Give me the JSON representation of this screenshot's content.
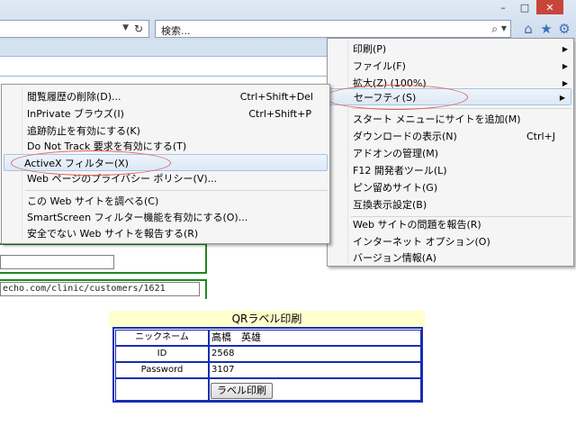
{
  "browser": {
    "search_placeholder": "検索...",
    "window_controls": [
      "–",
      "□",
      "✕"
    ],
    "icons": [
      "home-icon",
      "favorites-star-icon",
      "tools-gear-icon"
    ]
  },
  "page": {
    "url_text": "echo.com/clinic/customers/1621"
  },
  "tools_menu": {
    "items": [
      {
        "label": "印刷(P)",
        "submenu": true
      },
      {
        "label": "ファイル(F)",
        "submenu": true
      },
      {
        "label": "拡大(Z) (100%)",
        "submenu": true
      },
      {
        "label": "セーフティ(S)",
        "submenu": true,
        "highlighted": true
      },
      {
        "label": "スタート メニューにサイトを追加(M)"
      },
      {
        "label": "ダウンロードの表示(N)",
        "shortcut": "Ctrl+J"
      },
      {
        "label": "アドオンの管理(M)"
      },
      {
        "label": "F12 開発者ツール(L)"
      },
      {
        "label": "ピン留めサイト(G)"
      },
      {
        "label": "互換表示設定(B)"
      },
      {
        "label": "Web サイトの問題を報告(R)"
      },
      {
        "label": "インターネット オプション(O)"
      },
      {
        "label": "バージョン情報(A)"
      }
    ]
  },
  "safety_menu": {
    "items": [
      {
        "label": "閲覧履歴の削除(D)...",
        "shortcut": "Ctrl+Shift+Del"
      },
      {
        "label": "InPrivate ブラウズ(I)",
        "shortcut": "Ctrl+Shift+P"
      },
      {
        "label": "追跡防止を有効にする(K)"
      },
      {
        "label": "Do Not Track 要求を有効にする(T)"
      },
      {
        "label": "ActiveX フィルター(X)",
        "highlighted": true
      },
      {
        "label": "Web ページのプライバシー ポリシー(V)..."
      },
      {
        "label": "この Web サイトを調べる(C)"
      },
      {
        "label": "SmartScreen フィルター機能を有効にする(O)..."
      },
      {
        "label": "安全でない Web サイトを報告する(R)"
      }
    ]
  },
  "qr_label": {
    "title": "QRラベル印刷",
    "nickname_label": "ニックネーム",
    "nickname_value": "高橋　英雄",
    "id_label": "ID",
    "id_value": "2568",
    "password_label": "Password",
    "password_value": "3107",
    "print_button": "ラベル印刷"
  },
  "colors": {
    "chrome": "#cfdcec",
    "menu_bg": "#f5f5f5",
    "highlight_oval": "#e06060",
    "form_border": "#1a2db0",
    "title_bg": "#ffffcc",
    "green_border": "#1e8a1e"
  }
}
